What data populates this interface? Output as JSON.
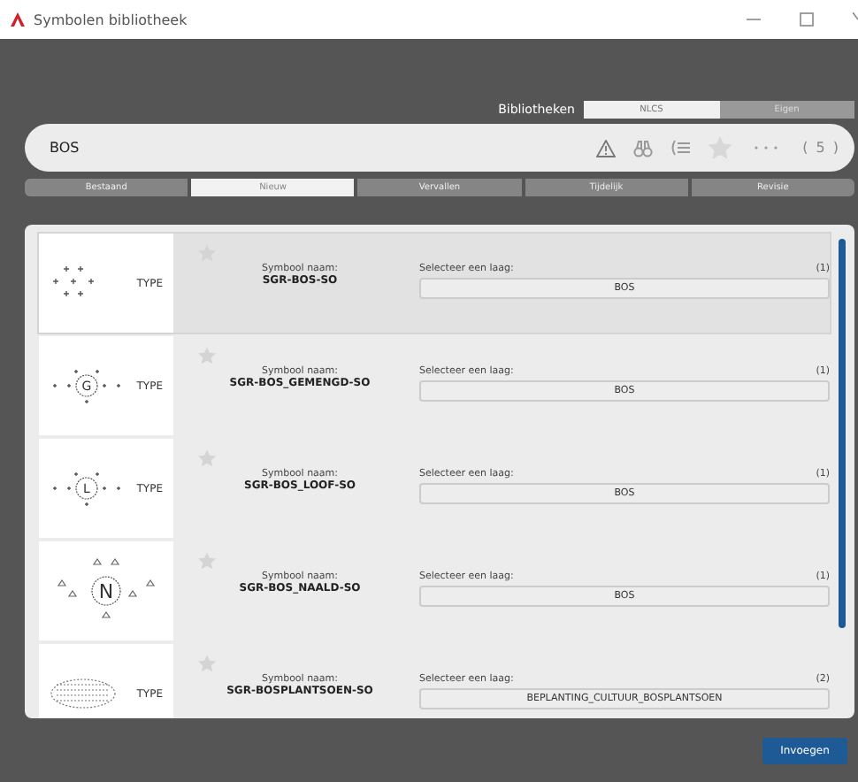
{
  "window": {
    "title": "Symbolen bibliotheek"
  },
  "libraries": {
    "label": "Bibliotheken",
    "options": [
      {
        "label": "NLCS",
        "selected": true
      },
      {
        "label": "Eigen",
        "selected": false
      }
    ]
  },
  "search": {
    "value": "BOS",
    "count": "( 5 )"
  },
  "filters": [
    {
      "label": "Bestaand",
      "selected": false
    },
    {
      "label": "Nieuw",
      "selected": true
    },
    {
      "label": "Vervallen",
      "selected": false
    },
    {
      "label": "Tijdelijk",
      "selected": false
    },
    {
      "label": "Revisie",
      "selected": false
    }
  ],
  "symbols": [
    {
      "kind": "dots",
      "type_label": "TYPE",
      "favorite": false,
      "selected": true,
      "name_label": "Symbool naam:",
      "name": "SGR-BOS-SO",
      "layer_label": "Selecteer een laag:",
      "layer_count": "(1)",
      "layer": "BOS"
    },
    {
      "kind": "circle",
      "letter": "G",
      "type_label": "TYPE",
      "favorite": false,
      "selected": false,
      "name_label": "Symbool naam:",
      "name": "SGR-BOS_GEMENGD-SO",
      "layer_label": "Selecteer een laag:",
      "layer_count": "(1)",
      "layer": "BOS"
    },
    {
      "kind": "circle",
      "letter": "L",
      "type_label": "TYPE",
      "favorite": false,
      "selected": false,
      "name_label": "Symbool naam:",
      "name": "SGR-BOS_LOOF-SO",
      "layer_label": "Selecteer een laag:",
      "layer_count": "(1)",
      "layer": "BOS"
    },
    {
      "kind": "trees",
      "letter": "N",
      "favorite": false,
      "selected": false,
      "name_label": "Symbool naam:",
      "name": "SGR-BOS_NAALD-SO",
      "layer_label": "Selecteer een laag:",
      "layer_count": "(1)",
      "layer": "BOS"
    },
    {
      "kind": "hatch",
      "type_label": "TYPE",
      "favorite": false,
      "selected": false,
      "name_label": "Symbool naam:",
      "name": "SGR-BOSPLANTSOEN-SO",
      "layer_label": "Selecteer een laag:",
      "layer_count": "(2)",
      "layer": "BEPLANTING_CULTUUR_BOSPLANTSOEN"
    }
  ],
  "insert_button": "Invoegen"
}
